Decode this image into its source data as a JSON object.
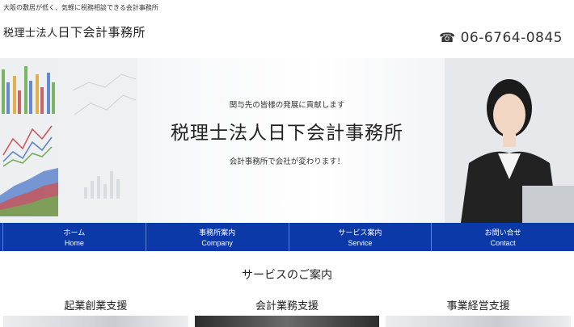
{
  "header": {
    "tagline": "大阪の敷居が低く、気軽に税務相談できる会計事務所",
    "logo_prefix": "税理士法人",
    "logo_name": "日下会計事務所",
    "phone_icon": "phone-icon",
    "phone": "06-6764-0845"
  },
  "hero": {
    "subtitle": "関与先の皆様の発展に貢献します",
    "title": "税理士法人日下会計事務所",
    "catchphrase": "会計事務所で会社が変わります！"
  },
  "nav": {
    "items": [
      {
        "jp": "ホーム",
        "en": "Home"
      },
      {
        "jp": "事務所案内",
        "en": "Company"
      },
      {
        "jp": "サービス案内",
        "en": "Service"
      },
      {
        "jp": "お問い合せ",
        "en": "Contact"
      }
    ]
  },
  "services": {
    "title": "サービスのご案内",
    "items": [
      {
        "label": "起業創業支援"
      },
      {
        "label": "会計業務支援"
      },
      {
        "label": "事業経営支援"
      }
    ]
  }
}
